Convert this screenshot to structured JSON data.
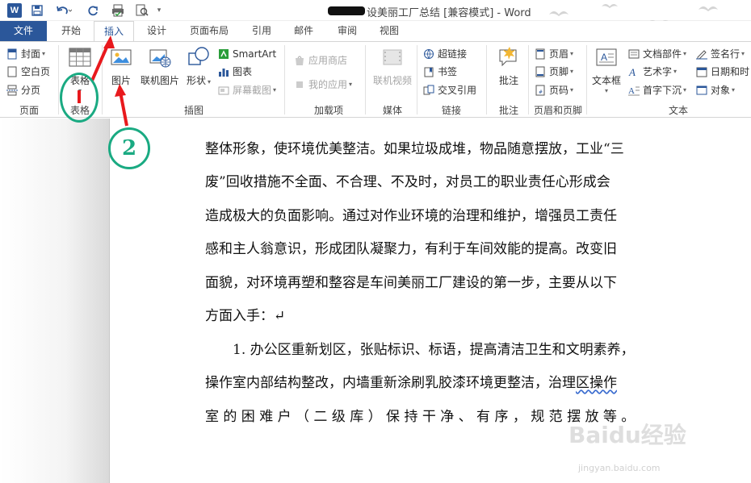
{
  "titlebar": {
    "document_title": "设美丽工厂总结 [兼容模式] - Word",
    "word_logo": "W",
    "qa_icons": [
      "save-icon",
      "undo-icon",
      "redo-icon",
      "print-preview-icon",
      "customize-icon"
    ]
  },
  "tabs": [
    {
      "label": "文件"
    },
    {
      "label": "开始"
    },
    {
      "label": "插入"
    },
    {
      "label": "设计"
    },
    {
      "label": "页面布局"
    },
    {
      "label": "引用"
    },
    {
      "label": "邮件"
    },
    {
      "label": "审阅"
    },
    {
      "label": "视图"
    }
  ],
  "ribbon": {
    "pages": {
      "cover": "封面",
      "blank": "空白页",
      "break": "分页",
      "label": "页面"
    },
    "tables": {
      "table": "表格",
      "label": "表格"
    },
    "illustrations": {
      "picture": "图片",
      "online_picture": "联机图片",
      "shapes": "形状",
      "smartart": "SmartArt",
      "chart": "图表",
      "screenshot": "屏幕截图",
      "label": "插图"
    },
    "addins": {
      "store": "应用商店",
      "my_apps": "我的应用",
      "label": "加载项"
    },
    "media": {
      "online_video": "联机视频",
      "label": "媒体"
    },
    "links": {
      "hyperlink": "超链接",
      "bookmark": "书签",
      "cross_ref": "交叉引用",
      "label": "链接"
    },
    "comments": {
      "comment": "批注",
      "label": "批注"
    },
    "header_footer": {
      "header": "页眉",
      "footer": "页脚",
      "page_number": "页码",
      "label": "页眉和页脚"
    },
    "text": {
      "textbox": "文本框",
      "quick_parts": "文档部件",
      "wordart": "艺术字",
      "dropcap": "首字下沉",
      "signature": "签名行",
      "datetime": "日期和时",
      "object": "对象",
      "label": "文本"
    }
  },
  "document": {
    "lines": [
      "整体形象，使环境优美整洁。如果垃圾成堆，物品随意摆放，工业“三",
      "废”回收措施不全面、不合理、不及时，对员工的职业责任心形成会",
      "造成极大的负面影响。通过对作业环境的治理和维护，增强员工责任",
      "感和主人翁意识，形成团队凝聚力，有利于车间效能的提高。改变旧",
      "面貌，对环境再塑和整容是车间美丽工厂建设的第一步，主要从以下",
      "方面入手：↵",
      "1. 办公区重新划区，张贴标识、标语，提高清洁卫生和文明素养，",
      "操作室内部结构整改，内墙重新涂刷乳胶漆环境更整洁，治理",
      "区操作",
      "室 的 困 难 户 （ 二 级 库 ） 保 持 干 净 、 有 序 ， 规 范 摆 放 等 。"
    ]
  },
  "annotations": {
    "step2": "2"
  },
  "watermark": {
    "main": "Baidu经验",
    "sub": "jingyan.baidu.com"
  },
  "colors": {
    "word_blue": "#2b579a",
    "annotation_green": "#1aaa82",
    "arrow_red": "#e8191d"
  }
}
